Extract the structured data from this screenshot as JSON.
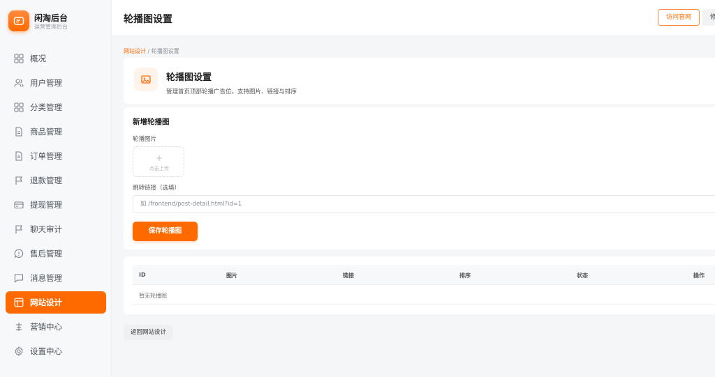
{
  "brand": {
    "title": "闲淘后台",
    "subtitle": "运营管理后台",
    "logo_icon": "wallet-icon"
  },
  "sidebar": {
    "items": [
      {
        "label": "概况",
        "icon": "dashboard-grid-icon",
        "active": false
      },
      {
        "label": "用户管理",
        "icon": "users-icon",
        "active": false
      },
      {
        "label": "分类管理",
        "icon": "category-grid-icon",
        "active": false
      },
      {
        "label": "商品管理",
        "icon": "document-icon",
        "active": false
      },
      {
        "label": "订单管理",
        "icon": "document-icon",
        "active": false
      },
      {
        "label": "退款管理",
        "icon": "flag-icon",
        "active": false
      },
      {
        "label": "提现管理",
        "icon": "card-icon",
        "active": false
      },
      {
        "label": "聊天审计",
        "icon": "flag-icon",
        "active": false
      },
      {
        "label": "售后管理",
        "icon": "message-alert-icon",
        "active": false
      },
      {
        "label": "消息管理",
        "icon": "chat-icon",
        "active": false
      },
      {
        "label": "网站设计",
        "icon": "layout-icon",
        "active": true
      },
      {
        "label": "营销中心",
        "icon": "marketing-icon",
        "active": false
      },
      {
        "label": "设置中心",
        "icon": "gear-icon",
        "active": false
      }
    ]
  },
  "header": {
    "title": "轮播图设置",
    "visit_label": "访问官网",
    "extra_label": "修"
  },
  "breadcrumb": {
    "parent": "网站设计",
    "separator": " / ",
    "current": "轮播图设置"
  },
  "intro": {
    "title": "轮播图设置",
    "description": "管理首页顶部轮播广告位，支持图片、链接与排序",
    "icon": "image-icon"
  },
  "form": {
    "title": "新增轮播图",
    "image_label": "轮播图片",
    "upload_plus": "+",
    "upload_text": "点击上传",
    "link_label": "跳转链接（选填）",
    "link_value": "",
    "link_placeholder": "如 /frontend/post-detail.html?id=1",
    "save_label": "保存轮播图"
  },
  "table": {
    "columns": [
      "ID",
      "图片",
      "链接",
      "排序",
      "状态",
      "操作"
    ],
    "empty_text": "暂无轮播图"
  },
  "back_label": "返回网站设计",
  "colors": {
    "accent": "#ff6a00",
    "accent_light": "#fff3ea",
    "sidebar_bg": "#f7f8fa"
  }
}
